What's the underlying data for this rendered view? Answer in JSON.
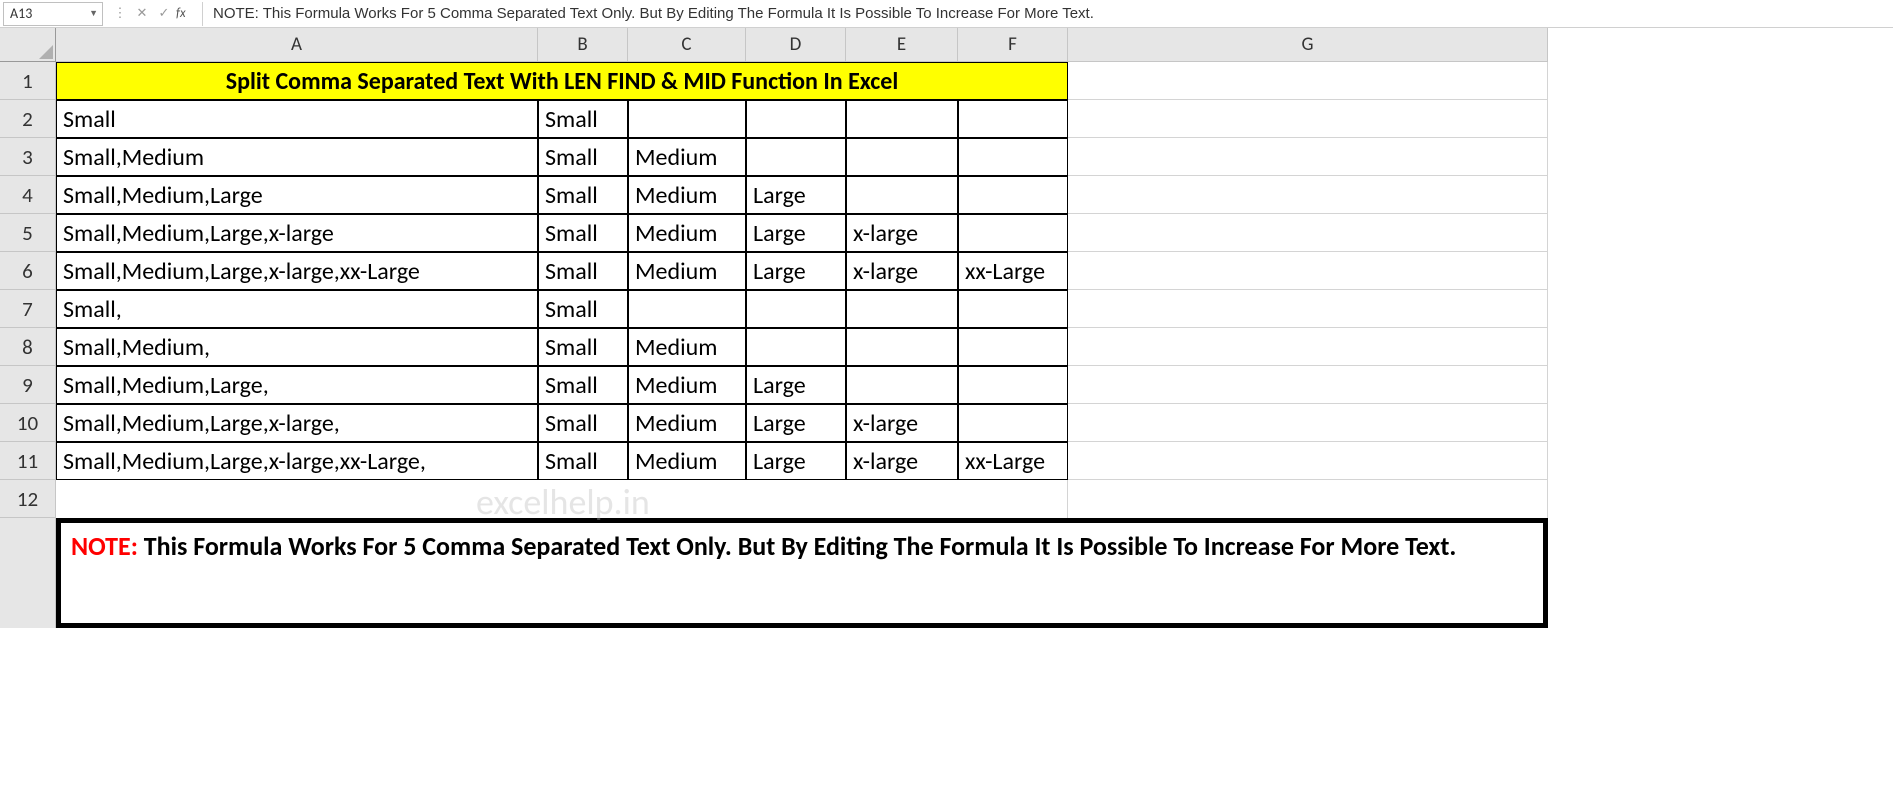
{
  "formula_bar": {
    "cell_ref": "A13",
    "cancel_icon": "✕",
    "enter_icon": "✓",
    "fx_label": "fx",
    "formula_text": "NOTE: This Formula Works For 5 Comma Separated Text Only. But By Editing The Formula It Is Possible To Increase For More Text."
  },
  "columns": [
    "A",
    "B",
    "C",
    "D",
    "E",
    "F",
    "G"
  ],
  "data_rows": [
    {
      "n": "1",
      "a": "Split Comma Separated Text With LEN FIND & MID Function In Excel",
      "b": "",
      "c": "",
      "d": "",
      "e": "",
      "f": ""
    },
    {
      "n": "2",
      "a": "Small",
      "b": "Small",
      "c": "",
      "d": "",
      "e": "",
      "f": ""
    },
    {
      "n": "3",
      "a": "Small,Medium",
      "b": "Small",
      "c": "Medium",
      "d": "",
      "e": "",
      "f": ""
    },
    {
      "n": "4",
      "a": "Small,Medium,Large",
      "b": "Small",
      "c": "Medium",
      "d": "Large",
      "e": "",
      "f": ""
    },
    {
      "n": "5",
      "a": "Small,Medium,Large,x-large",
      "b": "Small",
      "c": "Medium",
      "d": "Large",
      "e": "x-large",
      "f": ""
    },
    {
      "n": "6",
      "a": "Small,Medium,Large,x-large,xx-Large",
      "b": "Small",
      "c": "Medium",
      "d": "Large",
      "e": "x-large",
      "f": "xx-Large"
    },
    {
      "n": "7",
      "a": "Small,",
      "b": "Small",
      "c": "",
      "d": "",
      "e": "",
      "f": ""
    },
    {
      "n": "8",
      "a": "Small,Medium,",
      "b": "Small",
      "c": "Medium",
      "d": "",
      "e": "",
      "f": ""
    },
    {
      "n": "9",
      "a": "Small,Medium,Large,",
      "b": "Small",
      "c": "Medium",
      "d": "Large",
      "e": "",
      "f": ""
    },
    {
      "n": "10",
      "a": "Small,Medium,Large,x-large,",
      "b": "Small",
      "c": "Medium",
      "d": "Large",
      "e": "x-large",
      "f": ""
    },
    {
      "n": "11",
      "a": "Small,Medium,Large,x-large,xx-Large,",
      "b": "Small",
      "c": "Medium",
      "d": "Large",
      "e": "x-large",
      "f": "xx-Large"
    }
  ],
  "row12": "12",
  "watermark": "excelhelp.in",
  "note": {
    "prefix": "NOTE: ",
    "body": "This Formula Works For 5 Comma Separated Text Only. But By Editing The Formula It Is Possible To Increase For More Text."
  }
}
